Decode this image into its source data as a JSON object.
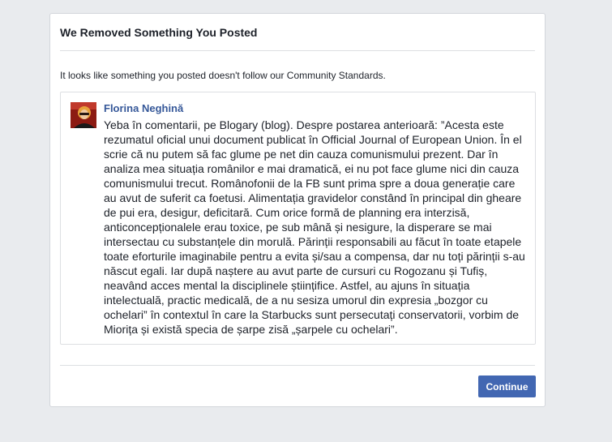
{
  "dialog": {
    "title": "We Removed Something You Posted",
    "notice": "It looks like something you posted doesn't follow our Community Standards.",
    "continue_label": "Continue"
  },
  "post": {
    "author": "Florina Neghină",
    "text": "Yeba în comentarii, pe Blogary (blog). Despre postarea anterioară: ”Acesta este rezumatul oficial unui document publicat în Official Journal of European Union. În el scrie că nu putem să fac glume pe net din cauza comunismului prezent. Dar în analiza mea situația românilor e mai dramatică, ei nu pot face glume nici din cauza comunismului trecut. Românofonii de la FB sunt prima spre a doua generație care au avut de suferit ca foetusi. Alimentația gravidelor constând în principal din gheare de pui era, desigur, deficitară. Cum orice formă de planning era interzisă, anticoncepționalele erau toxice, pe sub mână și nesigure, la disperare se mai intersectau cu substanțele din morulă. Părinții responsabili au făcut în toate etapele toate eforturile imaginabile pentru a evita și/sau a compensa, dar nu toți părinții s-au născut egali. Iar după naștere au avut parte de cursuri cu Rogozanu și Tufiș, neavând acces mental la disciplinele științifice. Astfel, au ajuns în situația intelectuală, practic medicală, de a nu sesiza umorul din expresia „bozgor cu ochelari” în contextul în care la Starbucks sunt persecutați conservatorii, vorbim de Miorița și există specia de șarpe zisă „șarpele cu ochelari”."
  },
  "colors": {
    "page_background": "#e9ebee",
    "author_link": "#365899",
    "button": "#4267b2"
  },
  "icons": {
    "avatar": "profile-photo"
  }
}
